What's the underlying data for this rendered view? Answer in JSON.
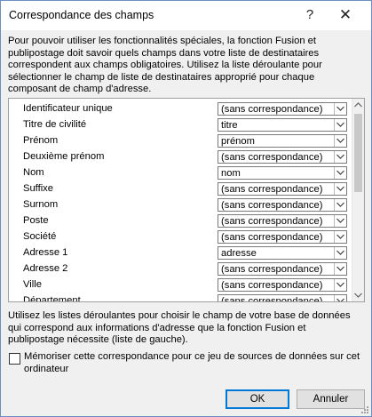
{
  "dialog": {
    "title": "Correspondance des champs",
    "help_glyph": "?",
    "close_glyph": "✕"
  },
  "intro_text": "Pour pouvoir utiliser les fonctionnalités spéciales, la fonction Fusion et publipostage doit savoir quels champs dans votre liste de destinataires correspondent aux champs obligatoires. Utilisez la liste déroulante pour sélectionner le champ de liste de destinataires approprié pour chaque composant de champ d'adresse.",
  "fields": [
    {
      "label": "Identificateur unique",
      "value": "(sans correspondance)"
    },
    {
      "label": "Titre de civilité",
      "value": "titre"
    },
    {
      "label": "Prénom",
      "value": "prénom"
    },
    {
      "label": "Deuxième prénom",
      "value": "(sans correspondance)"
    },
    {
      "label": "Nom",
      "value": "nom"
    },
    {
      "label": "Suffixe",
      "value": "(sans correspondance)"
    },
    {
      "label": "Surnom",
      "value": "(sans correspondance)"
    },
    {
      "label": "Poste",
      "value": "(sans correspondance)"
    },
    {
      "label": "Société",
      "value": "(sans correspondance)"
    },
    {
      "label": "Adresse 1",
      "value": "adresse"
    },
    {
      "label": "Adresse 2",
      "value": "(sans correspondance)"
    },
    {
      "label": "Ville",
      "value": "(sans correspondance)"
    },
    {
      "label": "Département",
      "value": "(sans correspondance)"
    }
  ],
  "help_text": "Utilisez les listes déroulantes pour choisir le champ de votre base de données qui correspond aux informations d'adresse que la fonction Fusion et publipostage nécessite (liste de gauche).",
  "remember_checkbox": {
    "label": "Mémoriser cette correspondance pour ce jeu de sources de données sur cet ordinateur",
    "checked": false
  },
  "buttons": {
    "ok": "OK",
    "cancel": "Annuler"
  },
  "icons": {
    "dropdown": "chevron-down-icon",
    "scroll_up": "scroll-up-arrow-icon",
    "scroll_down": "scroll-down-arrow-icon",
    "grip": "resize-grip-icon"
  },
  "colors": {
    "focus_border": "#0078d7",
    "dialog_background": "#f0f0f0"
  }
}
